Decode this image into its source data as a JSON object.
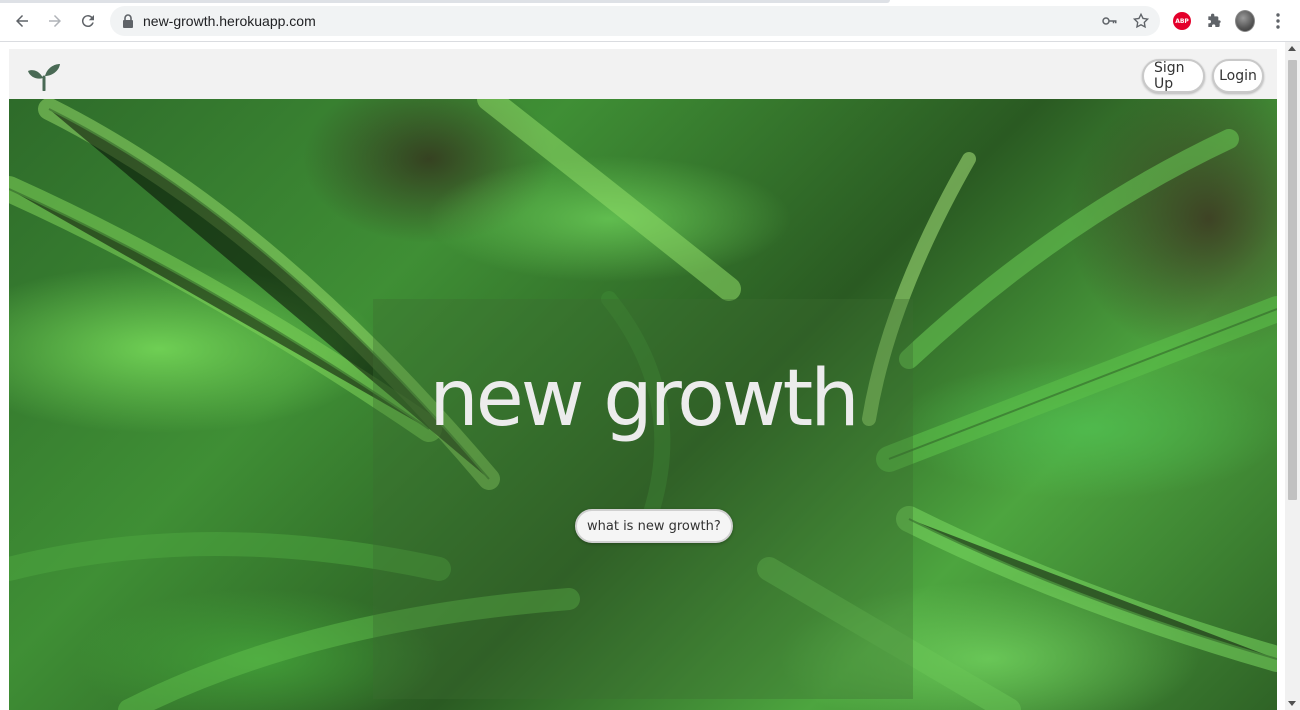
{
  "browser": {
    "url": "new-growth.herokuapp.com",
    "icons": {
      "back": "arrow-left-icon",
      "forward": "arrow-right-icon",
      "reload": "reload-icon",
      "lock": "lock-icon",
      "key": "key-icon",
      "bookmark": "star-icon",
      "adblock": "abp-icon",
      "extensions": "puzzle-icon",
      "profile": "avatar",
      "menu": "kebab-menu-icon"
    },
    "adblock_label": "ABP"
  },
  "site": {
    "logo": "sprout-icon",
    "nav": {
      "signup_label": "Sign Up",
      "login_label": "Login"
    },
    "hero": {
      "title": "new growth",
      "cta_label": "what is new growth?"
    }
  },
  "colors": {
    "nav_bg": "#f2f2f2",
    "logo": "#4a6a55",
    "hero_title": "#ececec",
    "foliage": "#3f8f35"
  }
}
